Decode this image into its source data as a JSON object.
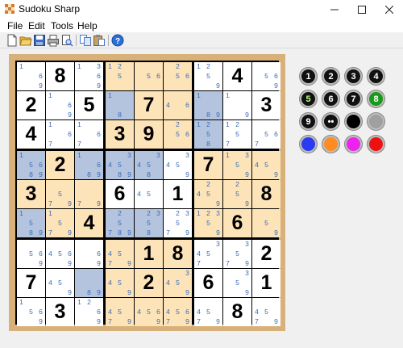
{
  "window": {
    "title": "Sudoku Sharp"
  },
  "menu": [
    "File",
    "Edit",
    "Tools",
    "Help"
  ],
  "toolbar": [
    {
      "name": "new-icon",
      "color": "#ffffff"
    },
    {
      "name": "open-icon",
      "color": "#e8b83a"
    },
    {
      "name": "save-icon",
      "color": "#3c6ac4"
    },
    {
      "name": "print-icon",
      "color": "#7a7a7a"
    },
    {
      "name": "print-preview-icon",
      "color": "#7a7a7a"
    },
    {
      "name": "copy-icon",
      "color": "#4a78c8"
    },
    {
      "name": "paste-icon",
      "color": "#c8a060"
    },
    {
      "name": "help-icon",
      "color": "#2a6fd6"
    }
  ],
  "colors": {
    "white": "#ffffff",
    "peach": "#fde3b8",
    "blue": "#b4c4de",
    "candidate": "#3b6cb8",
    "frame": "#d8b07a"
  },
  "grid": [
    [
      {
        "c": "1 69",
        "h": "w"
      },
      {
        "v": "8",
        "h": "w"
      },
      {
        "c": "13 69",
        "h": "w"
      },
      {
        "c": "12 5",
        "h": "p"
      },
      {
        "c": "56",
        "h": "p"
      },
      {
        "c": "25 6",
        "h": "p"
      },
      {
        "c": "12 5 9",
        "h": "w"
      },
      {
        "v": "4",
        "h": "w"
      },
      {
        "c": "5 69",
        "h": "w"
      }
    ],
    [
      {
        "v": "2",
        "h": "w"
      },
      {
        "c": "1 69",
        "h": "w"
      },
      {
        "v": "5",
        "h": "w"
      },
      {
        "c": "1 8",
        "h": "b"
      },
      {
        "v": "7",
        "h": "p"
      },
      {
        "c": "46",
        "h": "p"
      },
      {
        "c": "1 89",
        "h": "b"
      },
      {
        "c": "1 9",
        "h": "w"
      },
      {
        "v": "3",
        "h": "w"
      }
    ],
    [
      {
        "v": "4",
        "h": "w"
      },
      {
        "c": "1 6 7",
        "h": "w"
      },
      {
        "c": "1 6 7",
        "h": "w"
      },
      {
        "v": "3",
        "h": "p"
      },
      {
        "v": "9",
        "h": "p"
      },
      {
        "c": "25 6",
        "h": "p"
      },
      {
        "c": "12 5 8",
        "h": "b"
      },
      {
        "c": "12 5 7",
        "h": "w"
      },
      {
        "c": "56 7",
        "h": "w"
      }
    ],
    [
      {
        "c": "1 56 89",
        "h": "b"
      },
      {
        "v": "2",
        "h": "p"
      },
      {
        "c": "1 6 89",
        "h": "b"
      },
      {
        "c": "3 45 89",
        "h": "b"
      },
      {
        "c": "3 45 8",
        "h": "b"
      },
      {
        "c": "3 45 9",
        "h": "w"
      },
      {
        "v": "7",
        "h": "p"
      },
      {
        "c": "13 5 9",
        "h": "p"
      },
      {
        "c": "45 9",
        "h": "p"
      }
    ],
    [
      {
        "v": "3",
        "h": "p"
      },
      {
        "c": "5 7 9",
        "h": "p"
      },
      {
        "c": "7 9",
        "h": "p"
      },
      {
        "v": "6",
        "h": "w"
      },
      {
        "c": "45",
        "h": "w"
      },
      {
        "v": "1",
        "h": "w"
      },
      {
        "c": "2 45 9",
        "h": "p"
      },
      {
        "c": "2 5 9",
        "h": "p"
      },
      {
        "v": "8",
        "h": "p"
      }
    ],
    [
      {
        "c": "1 5 89",
        "h": "b"
      },
      {
        "c": "1 5 7 9",
        "h": "p"
      },
      {
        "v": "4",
        "h": "p"
      },
      {
        "c": "2 5 789",
        "h": "b"
      },
      {
        "c": "23 5 8",
        "h": "b"
      },
      {
        "c": "23 5 79",
        "h": "w"
      },
      {
        "c": "123 5 9",
        "h": "p"
      },
      {
        "v": "6",
        "h": "p"
      },
      {
        "c": "5 9",
        "h": "p"
      }
    ],
    [
      {
        "c": "56 9",
        "h": "w"
      },
      {
        "c": "456 9",
        "h": "w"
      },
      {
        "c": "6 9",
        "h": "w"
      },
      {
        "c": "45 79",
        "h": "p"
      },
      {
        "v": "1",
        "h": "p"
      },
      {
        "v": "8",
        "h": "p"
      },
      {
        "c": "3 45 7",
        "h": "w"
      },
      {
        "c": "3 5 79",
        "h": "w"
      },
      {
        "v": "2",
        "h": "w"
      }
    ],
    [
      {
        "v": "7",
        "h": "w"
      },
      {
        "c": "45 9",
        "h": "w"
      },
      {
        "c": "89",
        "h": "b"
      },
      {
        "c": "45 9",
        "h": "p"
      },
      {
        "v": "2",
        "h": "p"
      },
      {
        "c": "3 45 9",
        "h": "p"
      },
      {
        "v": "6",
        "h": "w"
      },
      {
        "c": "3 5 9",
        "h": "w"
      },
      {
        "v": "1",
        "h": "w"
      }
    ],
    [
      {
        "c": "1 56 9",
        "h": "w"
      },
      {
        "v": "3",
        "h": "w"
      },
      {
        "c": "12 6 9",
        "h": "w"
      },
      {
        "c": "45 79",
        "h": "p"
      },
      {
        "c": "456 9",
        "h": "p"
      },
      {
        "c": "456 79",
        "h": "p"
      },
      {
        "c": "45 79",
        "h": "w"
      },
      {
        "v": "8",
        "h": "w"
      },
      {
        "c": "45 79",
        "h": "w"
      }
    ]
  ],
  "palette": [
    {
      "name": "digit-1-button",
      "label": "1",
      "fill": "#111111",
      "text": "#ffffff"
    },
    {
      "name": "digit-2-button",
      "label": "2",
      "fill": "#111111",
      "text": "#ffffff"
    },
    {
      "name": "digit-3-button",
      "label": "3",
      "fill": "#111111",
      "text": "#ffffff"
    },
    {
      "name": "digit-4-button",
      "label": "4",
      "fill": "#111111",
      "text": "#ffffff"
    },
    {
      "name": "digit-5-button",
      "label": "5",
      "fill": "#111111",
      "text": "#b8ff80"
    },
    {
      "name": "digit-6-button",
      "label": "6",
      "fill": "#111111",
      "text": "#ffffff"
    },
    {
      "name": "digit-7-button",
      "label": "7",
      "fill": "#111111",
      "text": "#ffffff"
    },
    {
      "name": "digit-8-button",
      "label": "8",
      "fill": "#1a9a1a",
      "text": "#ffffff"
    },
    {
      "name": "digit-9-button",
      "label": "9",
      "fill": "#111111",
      "text": "#ffffff"
    },
    {
      "name": "pencil-mark-button",
      "label": "••",
      "fill": "#111111",
      "text": "#ffffff"
    },
    {
      "name": "color-black-button",
      "label": "",
      "fill": "#000000",
      "text": "#ffffff"
    },
    {
      "name": "color-gray-button",
      "label": "",
      "fill": "#a0a0a0",
      "text": "#ffffff"
    },
    {
      "name": "color-blue-button",
      "label": "",
      "fill": "#2b3cf0",
      "text": "#ffffff"
    },
    {
      "name": "color-orange-button",
      "label": "",
      "fill": "#ff8c22",
      "text": "#ffffff"
    },
    {
      "name": "color-magenta-button",
      "label": "",
      "fill": "#ee22ee",
      "text": "#ffffff"
    },
    {
      "name": "color-red-button",
      "label": "",
      "fill": "#ee1111",
      "text": "#ffffff"
    }
  ]
}
